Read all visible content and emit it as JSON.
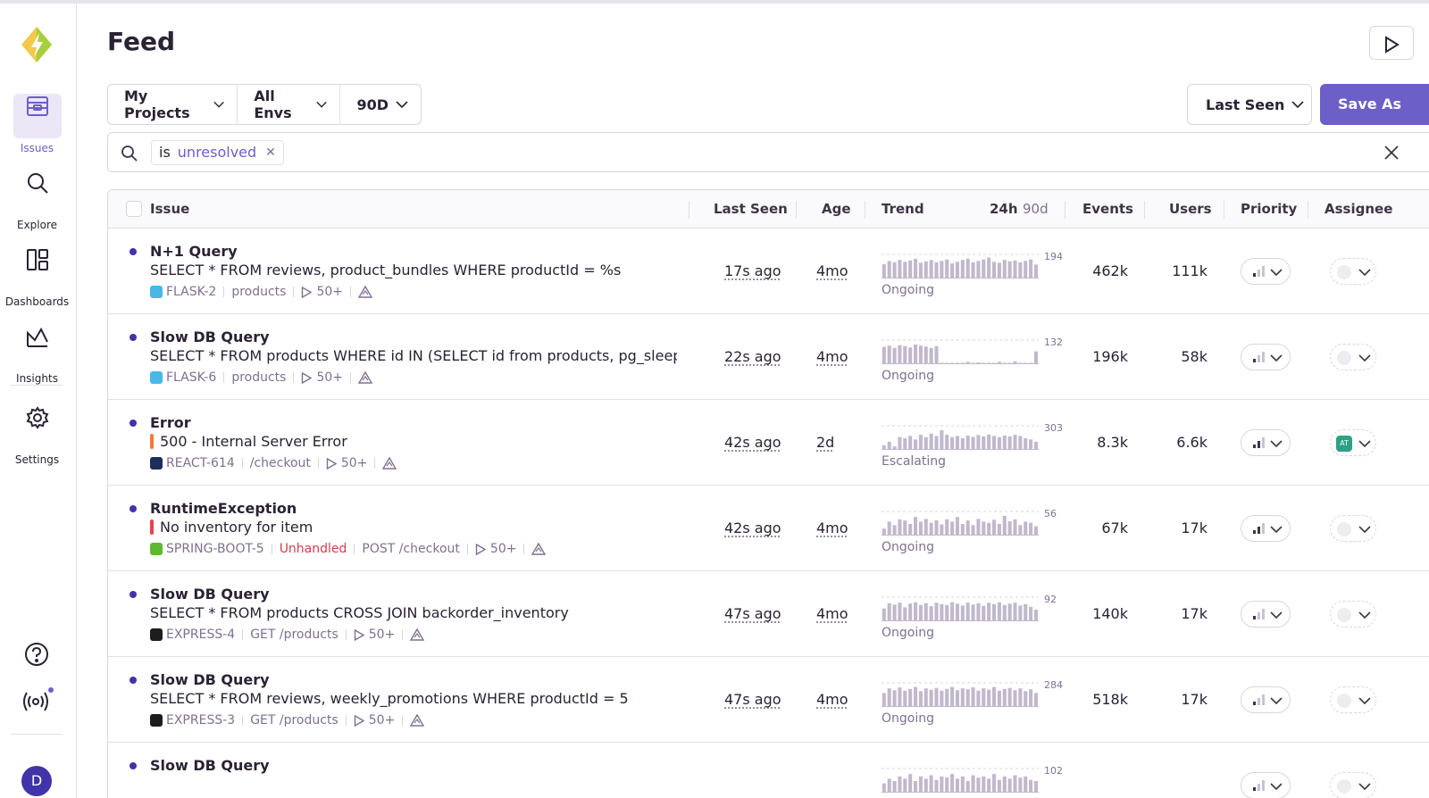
{
  "colors": {
    "accent": "#6c5fc7",
    "unhandled": "#d43b4d",
    "level_warning": "#f27a3a",
    "level_error": "#e8434c",
    "unread_dot": "#4034a8",
    "assignee_badge": "#2ba185"
  },
  "sidebar": {
    "items": [
      {
        "label": "Issues",
        "icon": "issues-icon",
        "active": true
      },
      {
        "label": "Explore",
        "icon": "search-icon"
      },
      {
        "label": "Dashboards",
        "icon": "dashboards-icon"
      },
      {
        "label": "Insights",
        "icon": "insights-icon"
      },
      {
        "label": "Settings",
        "icon": "gear-icon"
      }
    ],
    "bottom_icons": [
      "help-icon",
      "broadcast-icon"
    ],
    "avatar_initial": "D"
  },
  "header": {
    "title": "Feed"
  },
  "filters": {
    "project": "My Projects",
    "environment": "All Envs",
    "period": "90D"
  },
  "sort": {
    "label": "Last Seen"
  },
  "save_as": "Save As",
  "search": {
    "token_key": "is",
    "token_value": "unresolved"
  },
  "table": {
    "headers": {
      "issue": "Issue",
      "last_seen": "Last Seen",
      "age": "Age",
      "trend": "Trend",
      "trend_24h": "24h",
      "trend_90d": "90d",
      "events": "Events",
      "users": "Users",
      "priority": "Priority",
      "assignee": "Assignee"
    },
    "rows": [
      {
        "title": "N+1 Query",
        "message": "SELECT * FROM reviews, product_bundles WHERE productId = %s",
        "level": "",
        "short_id": "FLASK-2",
        "platform": "flask",
        "unhandled": "",
        "culprit": "products",
        "replays": "50+",
        "last_seen": "17s ago",
        "age": "4mo",
        "trend_max": "194",
        "trend": [
          0.62,
          0.75,
          0.7,
          0.8,
          0.72,
          0.78,
          0.85,
          0.68,
          0.74,
          0.8,
          0.7,
          0.76,
          0.82,
          0.65,
          0.72,
          0.8,
          0.86,
          0.7,
          0.76,
          0.82,
          0.9,
          0.72,
          0.68,
          0.8,
          0.74,
          0.78,
          0.7,
          0.76,
          0.82,
          0.6
        ],
        "trend_status": "Ongoing",
        "events": "462k",
        "users": "111k",
        "priority": 1,
        "assignee": ""
      },
      {
        "title": "Slow DB Query",
        "message": "SELECT * FROM products WHERE id IN (SELECT id from products, pg_sleep(…",
        "level": "",
        "short_id": "FLASK-6",
        "platform": "flask",
        "unhandled": "",
        "culprit": "products",
        "replays": "50+",
        "last_seen": "22s ago",
        "age": "4mo",
        "trend_max": "132",
        "trend": [
          0.75,
          0.8,
          0.7,
          0.82,
          0.78,
          0.72,
          0.85,
          0.8,
          0.76,
          0.7,
          0.78,
          0.06,
          0.05,
          0.04,
          0.06,
          0.05,
          0.1,
          0.05,
          0.08,
          0.04,
          0.06,
          0.05,
          0.1,
          0.04,
          0.05,
          0.12,
          0.06,
          0.05,
          0.04,
          0.55
        ],
        "trend_status": "Ongoing",
        "events": "196k",
        "users": "58k",
        "priority": 1,
        "assignee": ""
      },
      {
        "title": "Error",
        "message": "500 - Internal Server Error",
        "level": "warning",
        "short_id": "REACT-614",
        "platform": "react",
        "unhandled": "",
        "culprit": "/checkout",
        "replays": "50+",
        "last_seen": "42s ago",
        "age": "2d",
        "trend_max": "303",
        "trend": [
          0.2,
          0.35,
          0.15,
          0.55,
          0.5,
          0.6,
          0.45,
          0.65,
          0.55,
          0.7,
          0.6,
          0.85,
          0.65,
          0.55,
          0.6,
          0.5,
          0.62,
          0.56,
          0.64,
          0.58,
          0.66,
          0.6,
          0.55,
          0.62,
          0.58,
          0.65,
          0.6,
          0.5,
          0.45,
          0.35
        ],
        "trend_status": "Escalating",
        "events": "8.3k",
        "users": "6.6k",
        "priority": 2,
        "assignee": "AT"
      },
      {
        "title": "RuntimeException",
        "message": "No inventory for item",
        "level": "error",
        "short_id": "SPRING-BOOT-5",
        "platform": "spring",
        "unhandled": "Unhandled",
        "culprit": "POST /checkout",
        "replays": "50+",
        "last_seen": "42s ago",
        "age": "4mo",
        "trend_max": "56",
        "trend": [
          0.3,
          0.6,
          0.45,
          0.7,
          0.65,
          0.5,
          0.8,
          0.6,
          0.72,
          0.55,
          0.66,
          0.48,
          0.7,
          0.6,
          0.8,
          0.5,
          0.65,
          0.45,
          0.72,
          0.6,
          0.55,
          0.68,
          0.5,
          0.85,
          0.62,
          0.7,
          0.45,
          0.6,
          0.55,
          0.4
        ],
        "trend_status": "Ongoing",
        "events": "67k",
        "users": "17k",
        "priority": 2,
        "assignee": ""
      },
      {
        "title": "Slow DB Query",
        "message": "SELECT * FROM products CROSS JOIN backorder_inventory",
        "level": "",
        "short_id": "EXPRESS-4",
        "platform": "express",
        "unhandled": "",
        "culprit": "GET /products",
        "replays": "50+",
        "last_seen": "47s ago",
        "age": "4mo",
        "trend_max": "92",
        "trend": [
          0.55,
          0.78,
          0.72,
          0.8,
          0.6,
          0.76,
          0.82,
          0.7,
          0.78,
          0.65,
          0.8,
          0.74,
          0.7,
          0.82,
          0.76,
          0.68,
          0.8,
          0.72,
          0.78,
          0.66,
          0.8,
          0.74,
          0.82,
          0.7,
          0.76,
          0.8,
          0.68,
          0.74,
          0.62,
          0.5
        ],
        "trend_status": "Ongoing",
        "events": "140k",
        "users": "17k",
        "priority": 1,
        "assignee": ""
      },
      {
        "title": "Slow DB Query",
        "message": "SELECT * FROM reviews, weekly_promotions WHERE productId = 5",
        "level": "",
        "short_id": "EXPRESS-3",
        "platform": "express",
        "unhandled": "",
        "culprit": "GET /products",
        "replays": "50+",
        "last_seen": "47s ago",
        "age": "4mo",
        "trend_max": "284",
        "trend": [
          0.6,
          0.8,
          0.72,
          0.84,
          0.7,
          0.78,
          0.86,
          0.68,
          0.8,
          0.74,
          0.82,
          0.7,
          0.78,
          0.86,
          0.72,
          0.8,
          0.76,
          0.84,
          0.7,
          0.8,
          0.74,
          0.86,
          0.7,
          0.78,
          0.82,
          0.72,
          0.8,
          0.68,
          0.76,
          0.6
        ],
        "trend_status": "Ongoing",
        "events": "518k",
        "users": "17k",
        "priority": 1,
        "assignee": ""
      },
      {
        "title": "Slow DB Query",
        "message": "",
        "level": "",
        "short_id": "",
        "platform": "",
        "unhandled": "",
        "culprit": "",
        "replays": "",
        "last_seen": "",
        "age": "",
        "trend_max": "102",
        "trend": [
          0.4,
          0.6,
          0.5,
          0.7,
          0.6,
          0.8,
          0.5,
          0.7,
          0.6,
          0.75,
          0.55,
          0.7,
          0.65,
          0.8,
          0.6,
          0.7,
          0.5,
          0.75,
          0.65,
          0.7,
          0.6,
          0.8,
          0.55,
          0.7,
          0.6,
          0.75,
          0.65,
          0.7,
          0.55,
          0.5
        ],
        "trend_status": "",
        "events": "",
        "users": "",
        "priority": 1,
        "assignee": ""
      }
    ]
  }
}
